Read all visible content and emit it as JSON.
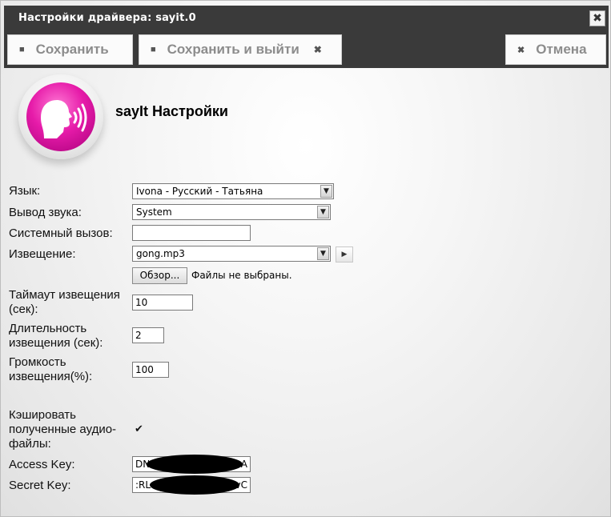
{
  "window": {
    "title": "Настройки драйвера: sayit.0",
    "close_icon": "close-icon"
  },
  "toolbar": {
    "save_label": "Сохранить",
    "save_exit_label": "Сохранить и выйти",
    "cancel_label": "Отмена",
    "save_icon": "floppy-icon",
    "close_icon": "close-icon"
  },
  "header": {
    "title": "sayIt Настройки",
    "logo_icon": "speaking-head-icon",
    "logo_color": "#e61ba9"
  },
  "form": {
    "language": {
      "label": "Язык:",
      "value": "Ivona - Русский - Татьяна"
    },
    "output": {
      "label": "Вывод звука:",
      "value": "System"
    },
    "system_call": {
      "label": "Системный вызов:",
      "value": ""
    },
    "announce": {
      "label": "Извещение:",
      "value": "gong.mp3",
      "browse_label": "Обзор...",
      "no_file_text": "Файлы не выбраны."
    },
    "announce_timeout": {
      "label_line1": "Таймаут извещения",
      "label_line2": "(сек):",
      "value": "10"
    },
    "announce_duration": {
      "label_line1": "Длительность",
      "label_line2": "извещения (сек):",
      "value": "2"
    },
    "announce_volume": {
      "label_line1": "Громкость",
      "label_line2": "извещения(%):",
      "value": "100"
    },
    "cache": {
      "label_line1": "Кэшировать",
      "label_line2": "полученные аудио-",
      "label_line3": "файлы:",
      "checked": true,
      "check_mark": "✔"
    },
    "access_key": {
      "label": "Access Key:",
      "prefix": "DN",
      "suffix": "A"
    },
    "secret_key": {
      "label": "Secret Key:",
      "prefix": ":RL",
      "suffix": "vC"
    }
  }
}
